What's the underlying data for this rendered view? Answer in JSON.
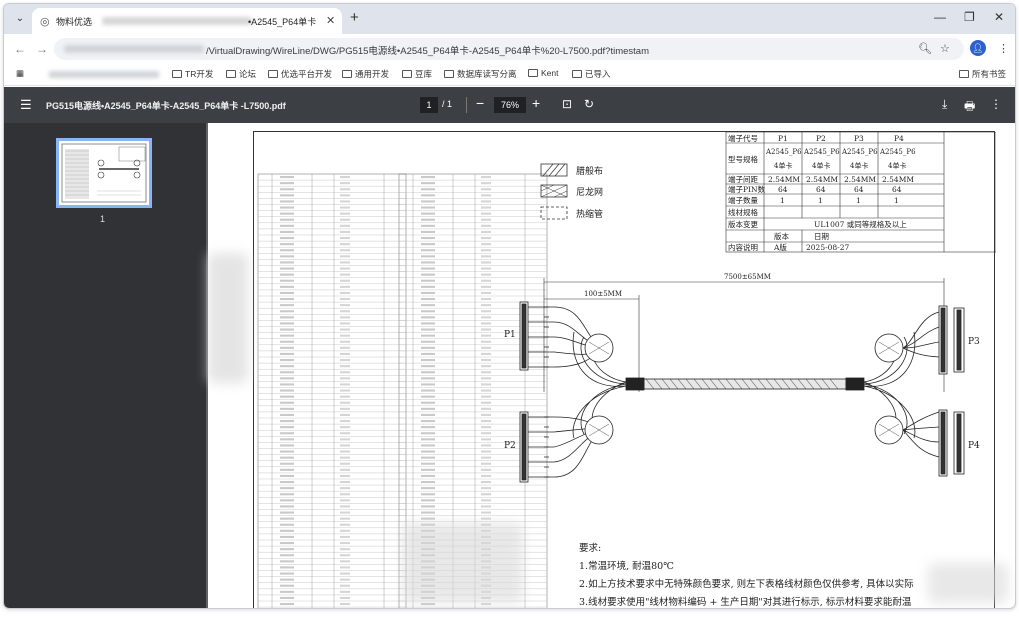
{
  "browser": {
    "tab": {
      "title_prefix": "物料优选",
      "title_suffix": "•A2545_P64单卡"
    },
    "url_visible": "/VirtualDrawing/WireLine/DWG/PG515电源线•A2545_P64单卡-A2545_P64单卡%20-L7500.pdf?timestam",
    "bookmarks": [
      "TR开发",
      "论坛",
      "优选平台开发",
      "通用开发",
      "豆库",
      "数据库读写分离",
      "Kent",
      "已导入"
    ],
    "bookmarks_right": "所有书签"
  },
  "pdf": {
    "doc_title": "PG515电源线•A2545_P64单卡-A2545_P64单卡 -L7500.pdf",
    "page_current": "1",
    "page_total": "/ 1",
    "zoom": "76%",
    "thumb_page": "1"
  },
  "drawing": {
    "legend": [
      "腊般布",
      "尼龙网",
      "热缩管"
    ],
    "table_header_label": "端子代号",
    "table_rows": [
      {
        "label": "型号规格",
        "values": [
          "A2545_P6\n4单卡",
          "A2545_P6\n4单卡",
          "A2545_P6\n4单卡",
          "A2545_P6\n4单卡"
        ]
      },
      {
        "label": "端子间距",
        "values": [
          "2.54MM",
          "2.54MM",
          "2.54MM",
          "2.54MM"
        ]
      },
      {
        "label": "端子PIN数",
        "values": [
          "64",
          "64",
          "64",
          "64"
        ]
      },
      {
        "label": "端子数量",
        "values": [
          "1",
          "1",
          "1",
          "1"
        ]
      }
    ],
    "connectors": [
      "P1",
      "P2",
      "P3",
      "P4"
    ],
    "wire_label": "UL1007 或同等规格及以上",
    "wire_row_label": "线材规格",
    "version_label": "版本变更",
    "version_cols": [
      "版本",
      "日期"
    ],
    "content_label": "内容说明",
    "version_value": "A版",
    "date_value": "2025-08-27",
    "dim_total": "7500±65MM",
    "dim_left": "100±5MM",
    "notes_title": "要求:",
    "notes": [
      "1.常温环境, 耐温80℃",
      "2.如上方技术要求中无特殊颜色要求, 则左下表格线材颜色仅供参考, 具体以实际",
      "3.线材要求使用\"线材物料编码 + 生产日期\"对其进行标示, 标示材料要求能耐温"
    ]
  }
}
